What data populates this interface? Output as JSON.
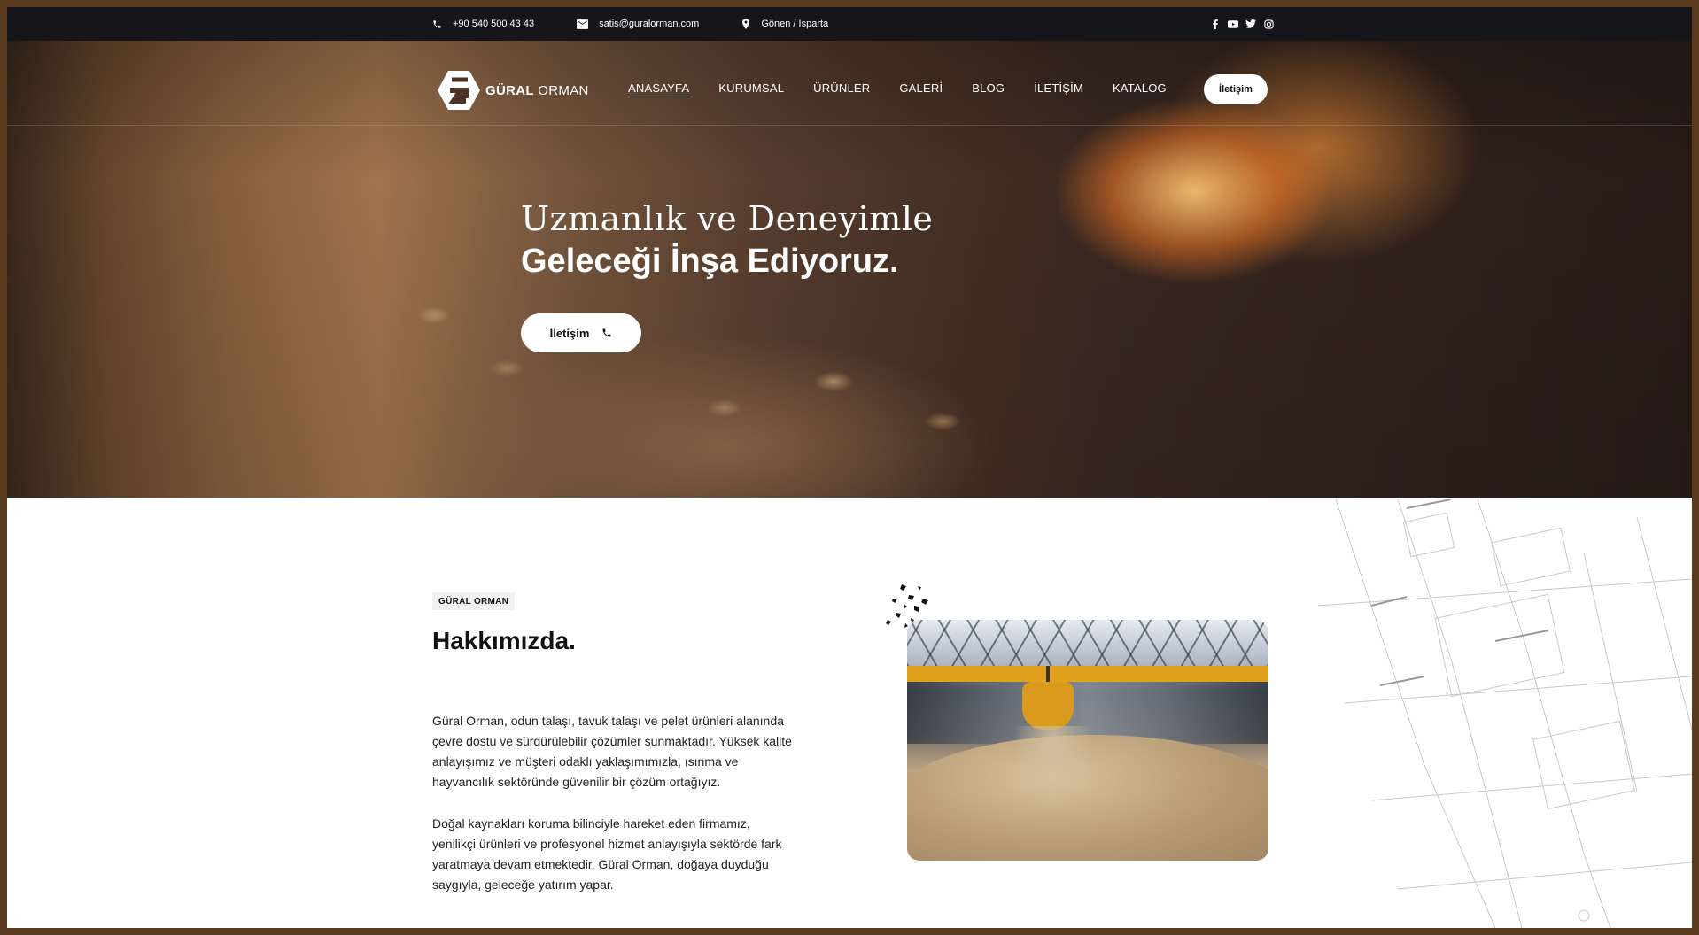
{
  "topbar": {
    "phone": "+90 540 500 43 43",
    "email": "satis@guralorman.com",
    "location": "Gönen / Isparta",
    "social": [
      "facebook-icon",
      "youtube-icon",
      "twitter-icon",
      "instagram-icon"
    ]
  },
  "brand": {
    "name_bold": "GÜRAL",
    "name_light": "ORMAN"
  },
  "nav": {
    "items": [
      {
        "label": "ANASAYFA",
        "active": true
      },
      {
        "label": "KURUMSAL"
      },
      {
        "label": "ÜRÜNLER"
      },
      {
        "label": "GALERİ"
      },
      {
        "label": "BLOG"
      },
      {
        "label": "İLETİŞİM"
      },
      {
        "label": "KATALOG"
      }
    ],
    "cta_label": "İletişim"
  },
  "hero": {
    "title_line1": "Uzmanlık ve Deneyimle",
    "title_line2": "Geleceği İnşa Ediyoruz.",
    "button_label": "İletişim"
  },
  "about": {
    "tag": "GÜRAL ORMAN",
    "title": "Hakkımızda",
    "title_dot": ".",
    "paragraph1": "Güral Orman, odun talaşı, tavuk talaşı ve pelet ürünleri alanında çevre dostu ve sürdürülebilir çözümler sunmaktadır. Yüksek kalite anlayışımız ve müşteri odaklı yaklaşımımızla, ısınma ve hayvancılık sektöründe güvenilir bir çözüm ortağıyız.",
    "paragraph2": "Doğal kaynakları koruma bilinciyle hareket eden firmamız, yenilikçi ürünleri ve profesyonel hizmet anlayışıyla sektörde fark yaratmaya devam etmektedir. Güral Orman, doğaya duyduğu saygıyla, geleceğe yatırım yapar."
  },
  "colors": {
    "accent": "#f3b72a",
    "topbar": "#15151a"
  }
}
